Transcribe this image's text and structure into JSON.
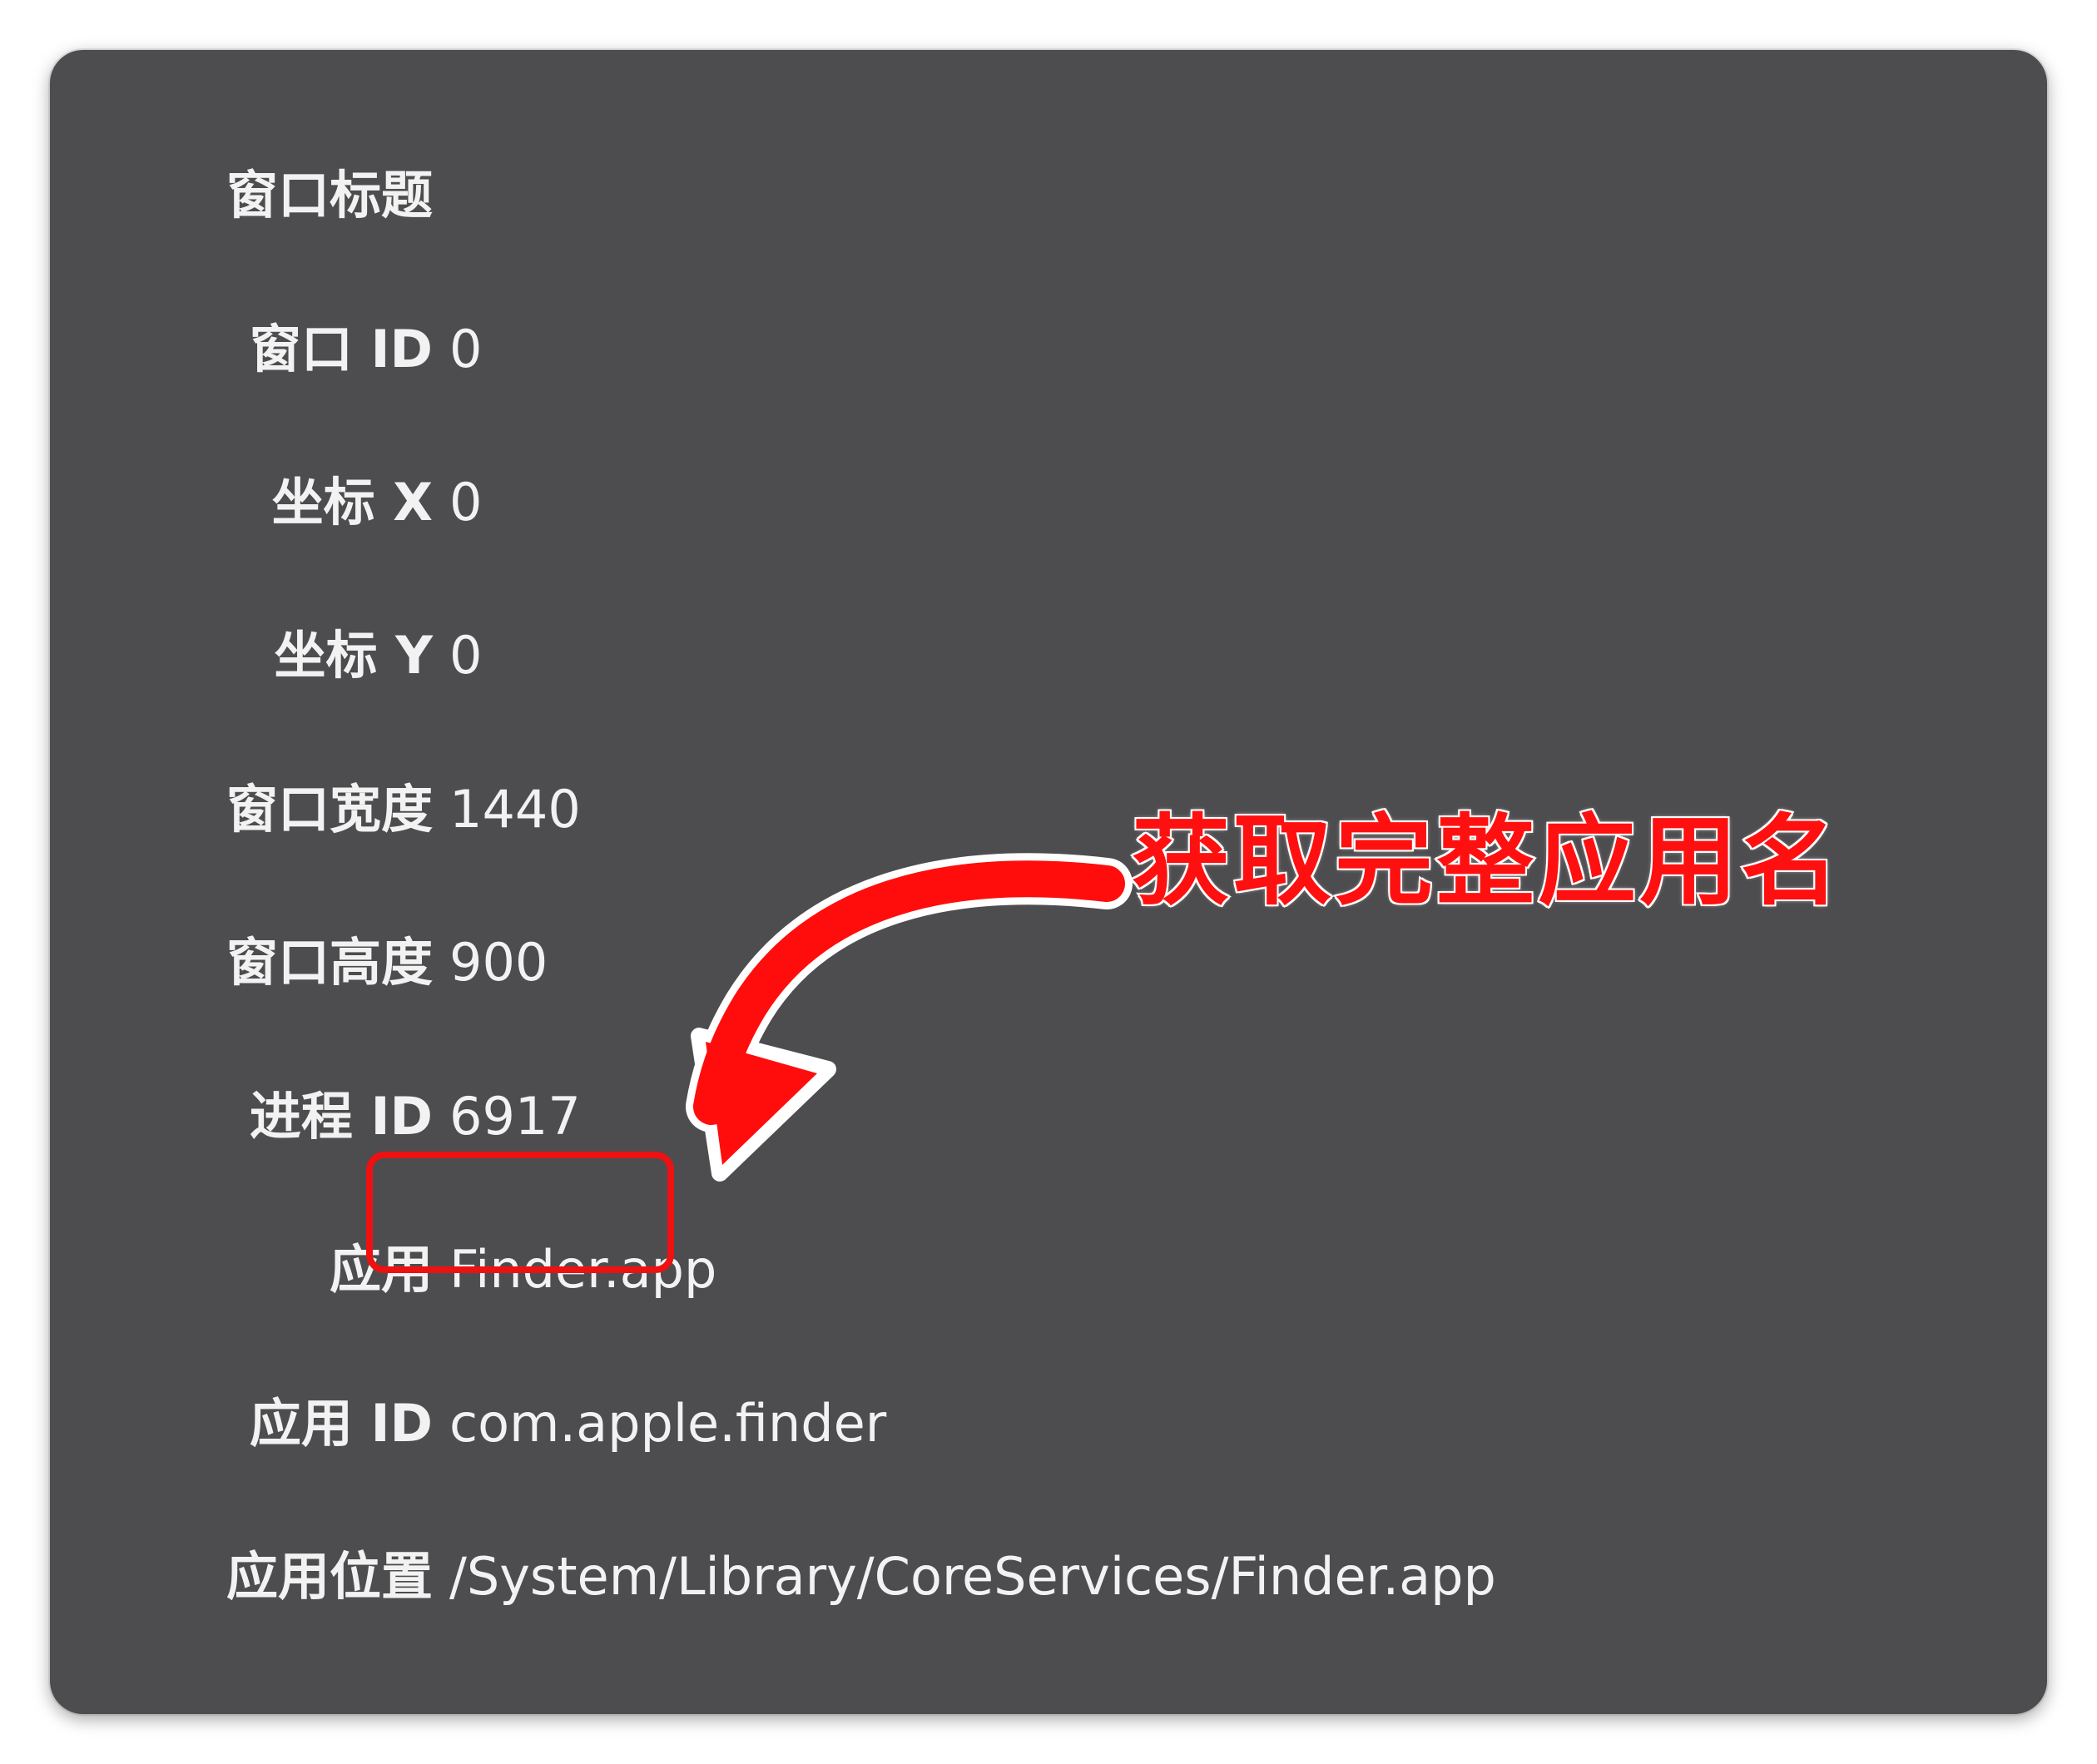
{
  "rows": [
    {
      "label": "窗口标题",
      "value": ""
    },
    {
      "label": "窗口 ID",
      "value": "0"
    },
    {
      "label": "坐标 X",
      "value": "0"
    },
    {
      "label": "坐标 Y",
      "value": "0"
    },
    {
      "label": "窗口宽度",
      "value": "1440"
    },
    {
      "label": "窗口高度",
      "value": "900"
    },
    {
      "label": "进程 ID",
      "value": "6917"
    },
    {
      "label": "应用",
      "value": "Finder.app"
    },
    {
      "label": "应用 ID",
      "value": "com.apple.finder"
    },
    {
      "label": "应用位置",
      "value": "/System/Library/CoreServices/Finder.app"
    }
  ],
  "annotation": {
    "callout_text": "获取完整应用名",
    "accent_color": "#ff1010",
    "arrow_icon": "curved-arrow-icon"
  },
  "colors": {
    "panel_bg": "#4d4d50",
    "text": "#f2f2f2",
    "highlight": "#ee1111"
  }
}
